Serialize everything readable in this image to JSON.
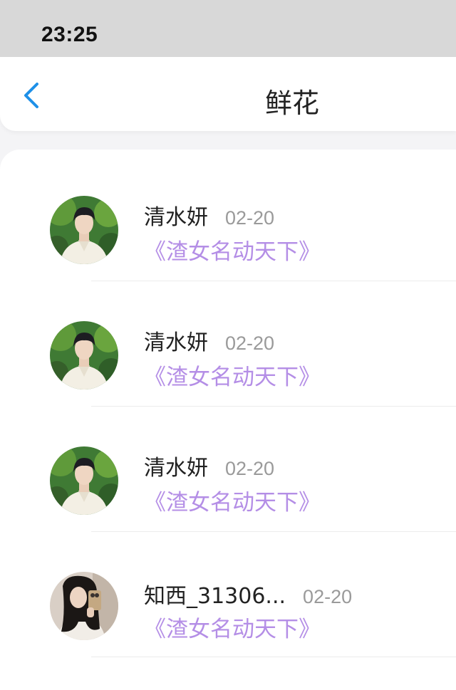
{
  "status_bar": {
    "time": "23:25"
  },
  "header": {
    "title": "鲜花"
  },
  "items": [
    {
      "name": "清水妍",
      "date": "02-20",
      "work": "《渣女名动天下》",
      "avatar": "avatar-man"
    },
    {
      "name": "清水妍",
      "date": "02-20",
      "work": "《渣女名动天下》",
      "avatar": "avatar-man"
    },
    {
      "name": "清水妍",
      "date": "02-20",
      "work": "《渣女名动天下》",
      "avatar": "avatar-man"
    },
    {
      "name": "知西_31306...",
      "date": "02-20",
      "work": "《渣女名动天下》",
      "avatar": "avatar-woman"
    }
  ],
  "colors": {
    "accent": "#1e90e8",
    "work_link": "#b48ee6",
    "date": "#9a9a9a",
    "status_bar": "#d8d8d8"
  }
}
